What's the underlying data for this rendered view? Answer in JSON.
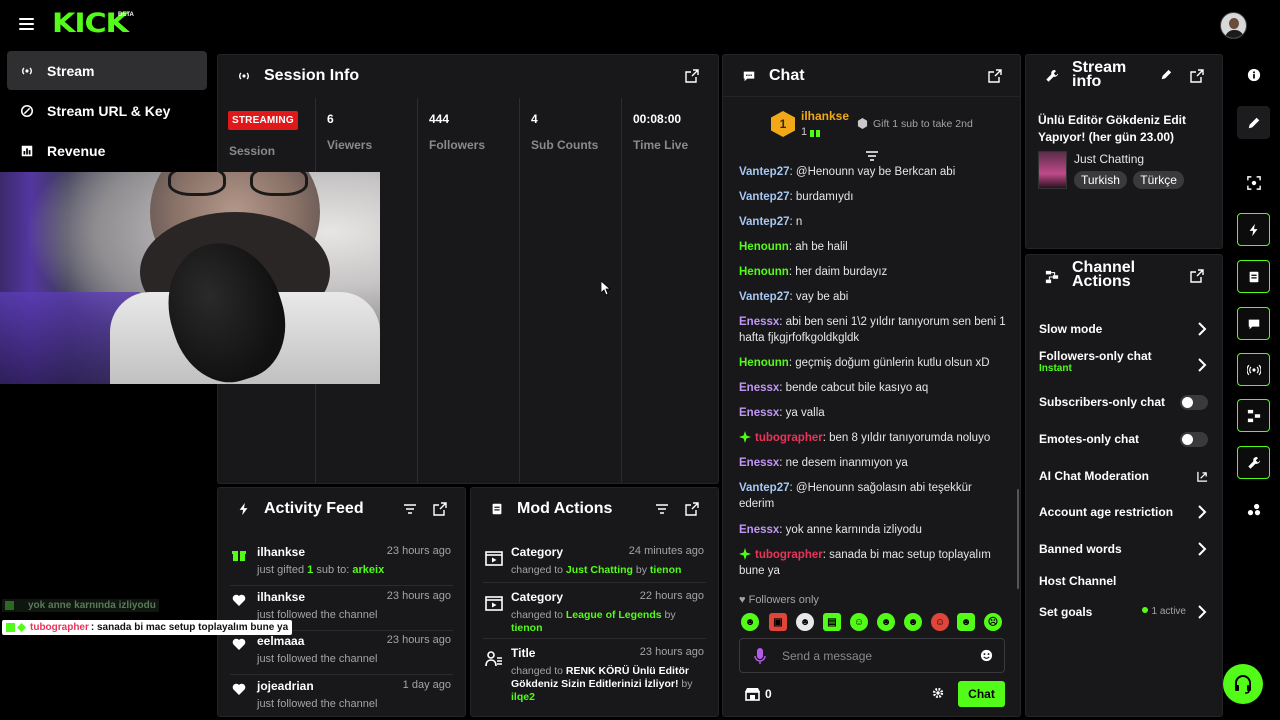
{
  "brand": {
    "logo": "KICK",
    "beta": "BETA"
  },
  "nav": {
    "items": [
      {
        "label": "Stream",
        "icon": "broadcast-icon",
        "active": true
      },
      {
        "label": "Stream URL & Key",
        "icon": "link-icon"
      },
      {
        "label": "Revenue",
        "icon": "chart-icon"
      }
    ]
  },
  "session": {
    "title": "Session Info",
    "status_badge": "STREAMING",
    "status_label": "Session",
    "stats": [
      {
        "value": "6",
        "label": "Viewers"
      },
      {
        "value": "444",
        "label": "Followers"
      },
      {
        "value": "4",
        "label": "Sub Counts"
      },
      {
        "value": "00:08:00",
        "label": "Time Live"
      }
    ]
  },
  "activity": {
    "title": "Activity Feed",
    "items": [
      {
        "name": "ilhankse",
        "time": "23 hours ago",
        "text": "just gifted ",
        "count": "1",
        "mid": " sub to: ",
        "target": "arkeix",
        "icon": "gift-icon"
      },
      {
        "name": "ilhankse",
        "time": "23 hours ago",
        "text": "just followed the channel",
        "icon": "heart-icon"
      },
      {
        "name": "eelmaaa",
        "time": "23 hours ago",
        "text": "just followed the channel",
        "icon": "heart-icon"
      },
      {
        "name": "jojeadrian",
        "time": "1 day ago",
        "text": "just followed the channel",
        "icon": "heart-icon"
      }
    ]
  },
  "mod": {
    "title": "Mod Actions",
    "items": [
      {
        "name": "Category",
        "time": "24 minutes ago",
        "pre": "changed to ",
        "value": "Just Chatting",
        "by": " by ",
        "user": "tienon"
      },
      {
        "name": "Category",
        "time": "22 hours ago",
        "pre": "changed to ",
        "value": "League of Legends",
        "by": " by ",
        "user": "tienon"
      },
      {
        "name": "Title",
        "time": "23 hours ago",
        "pre": "changed to ",
        "value": "RENK KÖRÜ Ünlü Editör Gökdeniz Sizin Editlerinizi İzliyor!",
        "by": " by ",
        "user": "ilqe2"
      }
    ]
  },
  "chat": {
    "title": "Chat",
    "top_gifter": {
      "rank": "1",
      "name": "ilhankse",
      "count": "1",
      "gift_text": "Gift 1 sub to take 2nd"
    },
    "messages": [
      {
        "user": "Vantep27",
        "color": "blue",
        "text": " @Henounn vay be Berkcan abi"
      },
      {
        "user": "Vantep27",
        "color": "blue",
        "text": " burdamıydı"
      },
      {
        "user": "Vantep27",
        "color": "blue",
        "text": " n"
      },
      {
        "user": "Henounn",
        "color": "green",
        "text": " ah be halil"
      },
      {
        "user": "Henounn",
        "color": "green",
        "text": " her daim burdayız"
      },
      {
        "user": "Vantep27",
        "color": "blue",
        "text": " vay be abi"
      },
      {
        "user": "Enessx",
        "color": "purple",
        "text": " abi ben seni 1\\2 yıldır tanıyorum sen beni 1 hafta fjkgjrfofkgoldkgldk"
      },
      {
        "user": "Henounn",
        "color": "green",
        "text": " geçmiş doğum günlerin kutlu olsun xD"
      },
      {
        "user": "Enessx",
        "color": "purple",
        "text": " bende cabcut bile kasıyo aq"
      },
      {
        "user": "Enessx",
        "color": "purple",
        "text": " ya valla"
      },
      {
        "user": "tubographer",
        "color": "red",
        "text": " ben 8 yıldır tanıyorumda noluyo",
        "badge": true
      },
      {
        "user": "Enessx",
        "color": "purple",
        "text": " ne desem inanmıyon ya"
      },
      {
        "user": "Vantep27",
        "color": "blue",
        "text": " @Henounn sağolasın abi teşekkür ederim"
      },
      {
        "user": "Enessx",
        "color": "purple",
        "text": " yok anne karnında izliyodu"
      },
      {
        "user": "tubographer",
        "color": "red",
        "text": " sanada bi mac setup toplayalım bune ya",
        "badge": true
      }
    ],
    "followers_only": "Followers only",
    "input_placeholder": "Send a message",
    "points": "0",
    "send_label": "Chat"
  },
  "overlay": {
    "line1": "yok anne karnında izliyodu",
    "line2_user": "tubographer",
    "line2_text": ": sanada bi mac setup toplayalım bune ya"
  },
  "stream_info": {
    "title": "Stream info",
    "stream_title": "Ünlü Editör Gökdeniz Edit Yapıyor! (her gün 23.00)",
    "category": "Just Chatting",
    "tags": [
      "Turkish",
      "Türkçe"
    ]
  },
  "channel_actions": {
    "title": "Channel Actions",
    "rows": [
      {
        "label": "Slow mode",
        "control": "chevron"
      },
      {
        "label": "Followers-only chat",
        "sublabel": "Instant",
        "control": "chevron"
      },
      {
        "label": "Subscribers-only chat",
        "control": "toggle"
      },
      {
        "label": "Emotes-only chat",
        "control": "toggle"
      },
      {
        "label": "AI Chat Moderation",
        "control": "external"
      },
      {
        "label": "Account age restriction",
        "control": "chevron"
      },
      {
        "label": "Banned words",
        "control": "chevron"
      },
      {
        "label": "Host Channel",
        "control": "none"
      },
      {
        "label": "Set goals",
        "status": "1 active",
        "control": "chevron"
      }
    ]
  },
  "colors": {
    "accent": "#53fc18",
    "live": "#e0181a",
    "panel": "#18181a"
  }
}
